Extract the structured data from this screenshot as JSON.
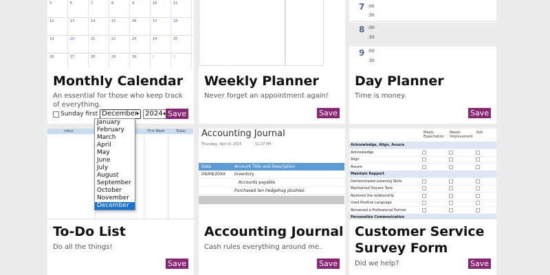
{
  "cards": [
    {
      "title": "Monthly Calendar",
      "desc": "An essential for those who keep track of everything.",
      "save": "Save"
    },
    {
      "title": "Weekly Planner",
      "desc": "Never forget an appointment again!",
      "save": "Save"
    },
    {
      "title": "Day Planner",
      "desc": "Time is money.",
      "save": "Save"
    },
    {
      "title": "To-Do List",
      "desc": "Do all the things!",
      "save": "Save"
    },
    {
      "title": "Accounting Journal",
      "desc": "Cash rules everything around me.",
      "save": "Save"
    },
    {
      "title": "Customer Service Survey Form",
      "desc": "Did we help?",
      "save": "Save"
    }
  ],
  "calendar_options": {
    "sunday_first_label": "Sunday first",
    "sunday_first_checked": false,
    "month_selected": "December",
    "year_selected": "2024",
    "months": [
      "January",
      "February",
      "March",
      "April",
      "May",
      "June",
      "July",
      "August",
      "September",
      "October",
      "November",
      "December"
    ]
  },
  "month_thumb": {
    "rows": [
      [
        "5",
        "6",
        "7",
        "8",
        "9",
        "10",
        "11"
      ],
      [
        "12",
        "13",
        "14",
        "15",
        "16",
        "17",
        "18"
      ],
      [
        "19",
        "20",
        "21",
        "22",
        "23",
        "24",
        "25"
      ],
      [
        "26",
        "27",
        "28",
        "29",
        "30",
        "1",
        "2"
      ]
    ]
  },
  "day_thumb": {
    "hours": [
      "7",
      "8",
      "9"
    ],
    "minute_label": ":00",
    "half_label": ":30"
  },
  "todo_thumb": {
    "headers": [
      "Inbox",
      "This Week",
      "Today"
    ]
  },
  "journal_thumb": {
    "title": "Accounting Journal",
    "date": "Thursday, April 9, 2015",
    "time": "11:27 PM",
    "col_date": "Date",
    "col_account": "Account Title and Description",
    "rows": [
      {
        "date": "04/09/20XX",
        "text": "Inventory"
      },
      {
        "date": "",
        "text": "Accounts payable"
      },
      {
        "date": "",
        "text": "Purchased ten hedgehog plushies"
      }
    ]
  },
  "survey_thumb": {
    "col_headers": [
      "Meets Expectation",
      "Needs Improvement",
      "N/A"
    ],
    "rows": [
      {
        "text": "Acknowledge, Align, Assure",
        "section": true
      },
      {
        "text": "Acknowledge",
        "section": false
      },
      {
        "text": "Align",
        "section": false
      },
      {
        "text": "Assure",
        "section": false
      },
      {
        "text": "Maintain Rapport",
        "section": true
      },
      {
        "text": "Demonstrated Listening Skills",
        "section": false
      },
      {
        "text": "Maintained Sincere Tone",
        "section": false
      },
      {
        "text": "Restored the relationship",
        "section": false
      },
      {
        "text": "Used Positive Language",
        "section": false
      },
      {
        "text": "Remained a Professional Partner",
        "section": false
      },
      {
        "text": "Personalize Communication",
        "section": true
      }
    ]
  },
  "colors": {
    "save_bg": "#8a2574",
    "dropdown_highlight": "#1a73d9",
    "journal_header": "#5b9bd5"
  }
}
